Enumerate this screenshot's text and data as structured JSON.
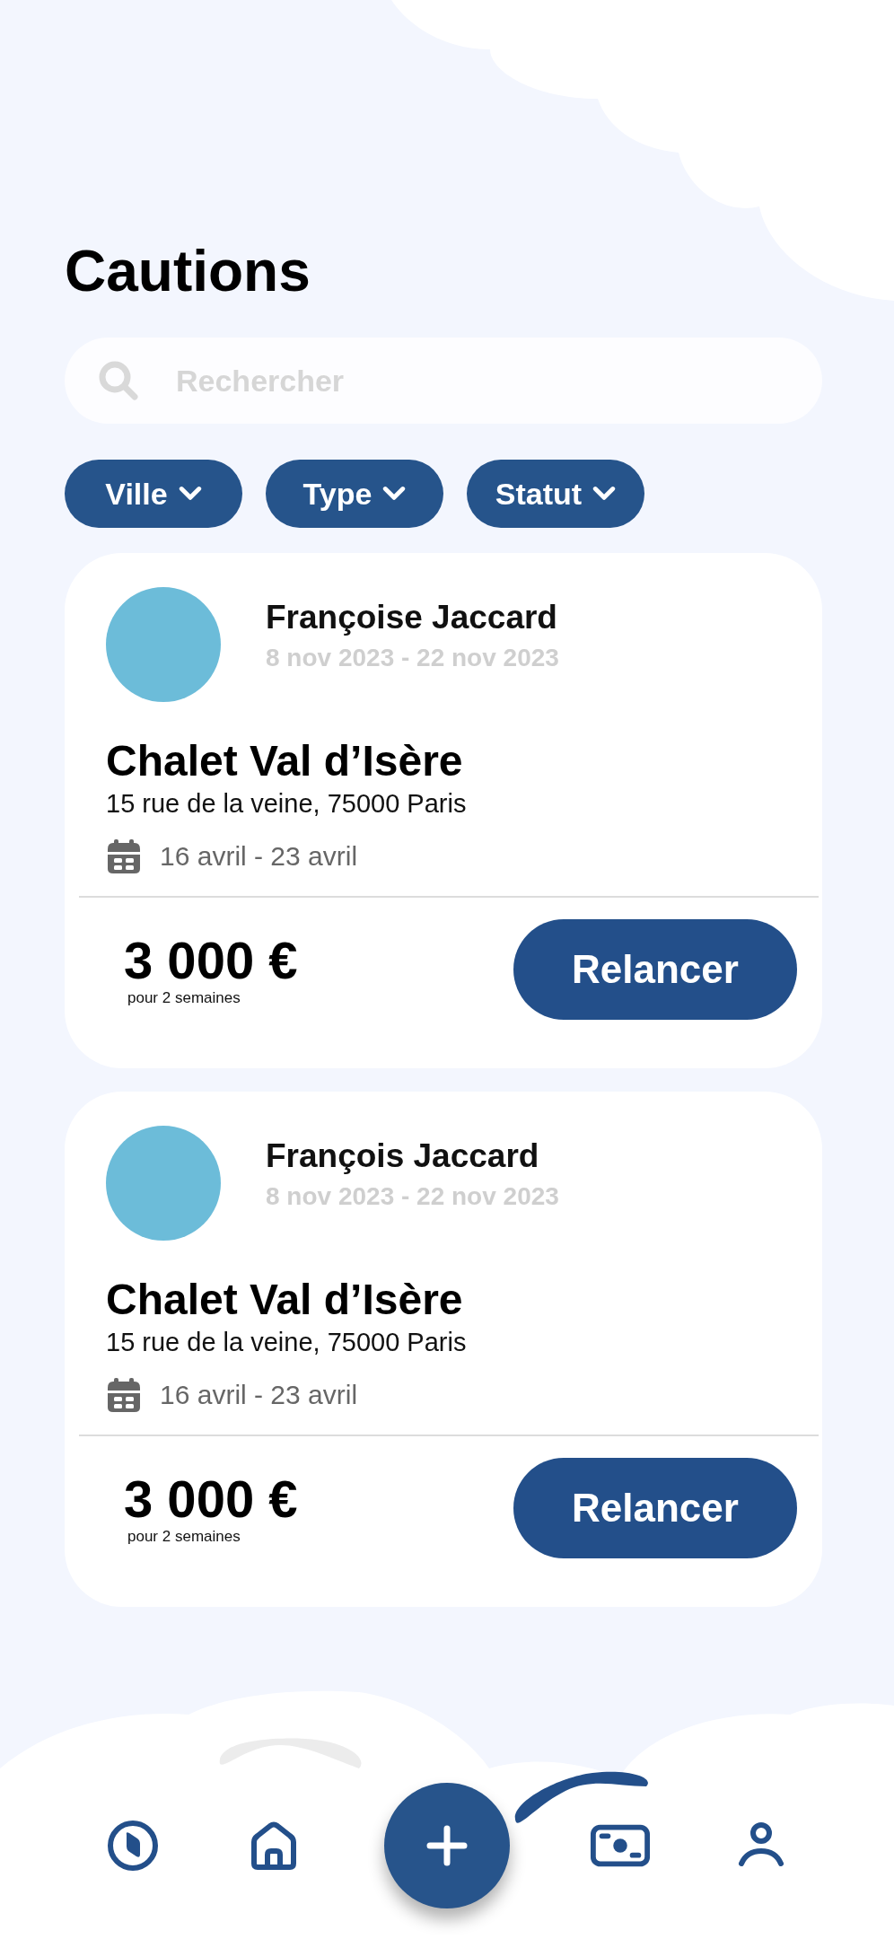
{
  "title": "Cautions",
  "search": {
    "placeholder": "Rechercher"
  },
  "filters": [
    {
      "label": "Ville"
    },
    {
      "label": "Type"
    },
    {
      "label": "Statut"
    }
  ],
  "cards": [
    {
      "name": "Françoise Jaccard",
      "dates": "8 nov 2023 - 22 nov 2023",
      "property": "Chalet Val d’Isère",
      "address": "15 rue de la veine, 75000 Paris",
      "period": "16 avril - 23 avril",
      "price": "3 000 €",
      "price_note": "pour 2 semaines",
      "action": "Relancer"
    },
    {
      "name": "François Jaccard",
      "dates": "8 nov 2023 - 22 nov 2023",
      "property": "Chalet Val d’Isère",
      "address": "15 rue de la veine, 75000 Paris",
      "period": "16 avril - 23 avril",
      "price": "3 000 €",
      "price_note": "pour 2 semaines",
      "action": "Relancer"
    }
  ],
  "nav": [
    {
      "kind": "compass"
    },
    {
      "kind": "home"
    },
    {
      "kind": "add"
    },
    {
      "kind": "money"
    },
    {
      "kind": "profile"
    }
  ]
}
